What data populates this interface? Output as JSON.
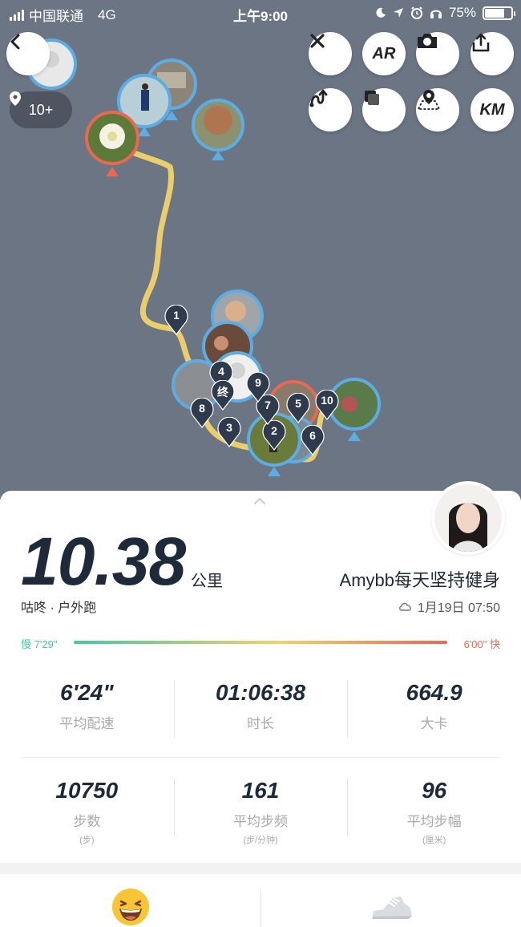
{
  "status_bar": {
    "carrier": "中国联通",
    "network": "4G",
    "time": "上午9:00",
    "battery": "75%",
    "battery_level": 0.75
  },
  "map": {
    "photo_count": "10+",
    "buttons": {
      "ar": "AR",
      "km": "KM"
    },
    "markers": [
      "1",
      "2",
      "3",
      "4",
      "5",
      "6",
      "7",
      "8",
      "9",
      "10",
      "终"
    ]
  },
  "summary": {
    "distance": "10.38",
    "unit": "公里",
    "activity": "咕咚 · 户外跑",
    "username": "Amybb每天坚持健身",
    "date": "1月19日 07:50"
  },
  "pace": {
    "slow": "慢 7'29\"",
    "fast": "6'00\" 快"
  },
  "stats_row1": [
    {
      "value": "6'24\"",
      "label": "平均配速"
    },
    {
      "value": "01:06:38",
      "label": "时长"
    },
    {
      "value": "664.9",
      "label": "大卡"
    }
  ],
  "stats_row2": [
    {
      "value": "10750",
      "label": "步数",
      "sub": "(步)"
    },
    {
      "value": "161",
      "label": "平均步频",
      "sub": "(步/分钟)"
    },
    {
      "value": "96",
      "label": "平均步幅",
      "sub": "(厘米)"
    }
  ],
  "colors": {
    "map_bg": "#6b7584",
    "route": "#f1d36a",
    "marker": "#2f3b4c",
    "pace_slow": "#45c89d",
    "pace_fast": "#e96852"
  }
}
